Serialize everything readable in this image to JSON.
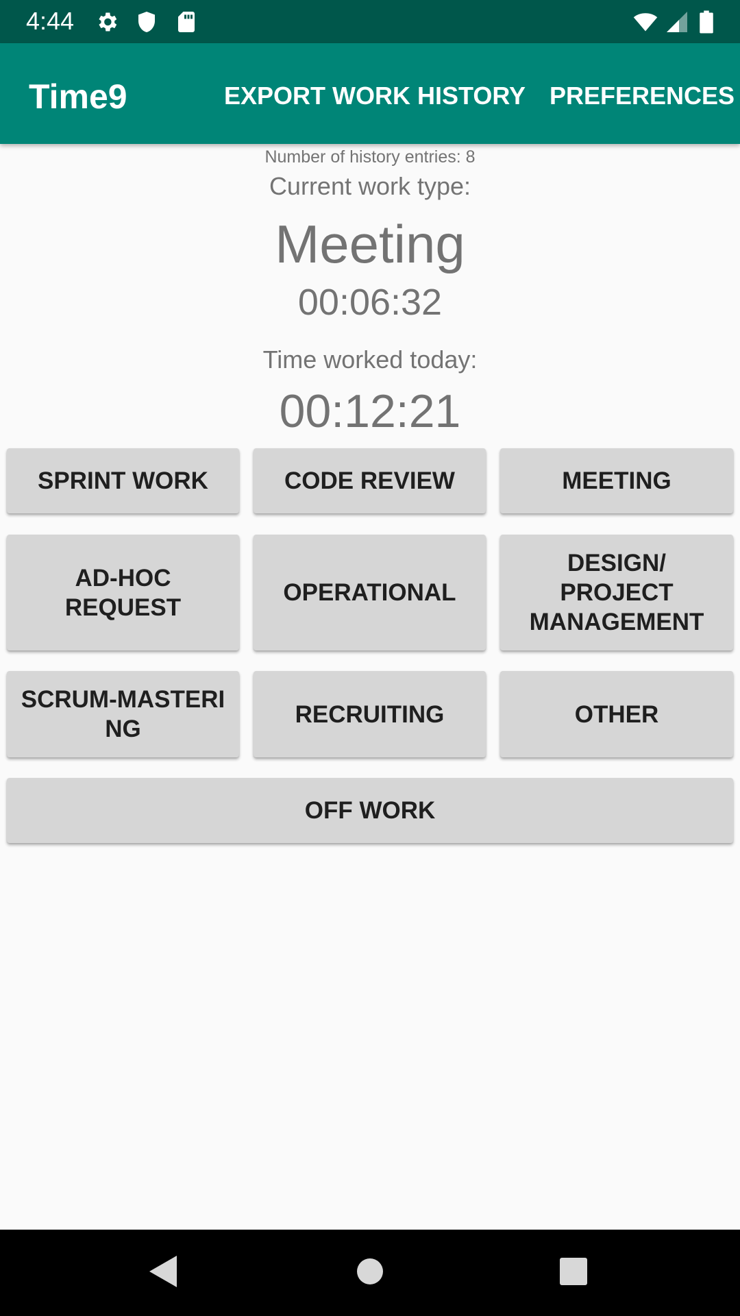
{
  "status_bar": {
    "time": "4:44",
    "icons": [
      "gear-icon",
      "shield-icon",
      "sd-card-icon",
      "wifi-icon",
      "cell-signal-icon",
      "battery-icon"
    ]
  },
  "app_bar": {
    "title": "Time9",
    "actions": {
      "export": "EXPORT WORK HISTORY",
      "preferences": "PREFERENCES"
    }
  },
  "summary": {
    "history_entries": "Number of history entries: 8",
    "current_type_label": "Current work type:",
    "current_type": "Meeting",
    "current_timer": "00:06:32",
    "worked_today_label": "Time worked today:",
    "worked_today": "00:12:21"
  },
  "work_types": {
    "sprint_work": "SPRINT WORK",
    "code_review": "CODE REVIEW",
    "meeting": "MEETING",
    "ad_hoc_request": "AD-HOC\nREQUEST",
    "operational": "OPERATIONAL",
    "design_project_management": "DESIGN/\nPROJECT\nMANAGEMENT",
    "scrum_mastering": "SCRUM-MASTERI\nNG",
    "recruiting": "RECRUITING",
    "other": "OTHER",
    "off_work": "OFF WORK"
  },
  "nav_bar": {
    "icons": [
      "back-icon",
      "home-icon",
      "recents-icon"
    ]
  },
  "colors": {
    "status_bar": "#00574b",
    "app_bar": "#008577",
    "background": "#fafafa",
    "button": "#d6d6d6",
    "button_text": "#1f1f1f",
    "secondary_text": "#737373"
  }
}
